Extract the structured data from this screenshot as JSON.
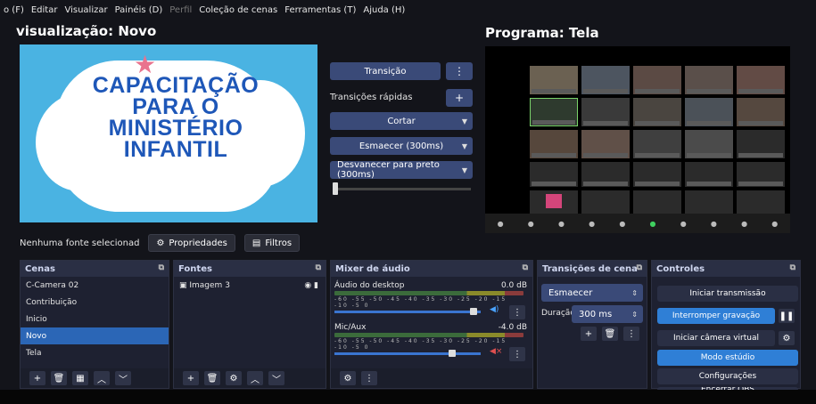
{
  "menu": [
    "o (F)",
    "Editar",
    "Visualizar",
    "Painéis (D)",
    "Perfil",
    "Coleção de cenas",
    "Ferramentas (T)",
    "Ajuda (H)"
  ],
  "preview": {
    "title": "visualização: Novo",
    "lines": [
      "CAPACITAÇÃO",
      "PARA O",
      "MINISTÉRIO",
      "INFANTIL"
    ]
  },
  "program": {
    "title": "Programa: Tela"
  },
  "transitions_panel": {
    "transition_label": "Transição",
    "quick_label": "Transições rápidas",
    "add_symbol": "+",
    "options": [
      "Cortar",
      "Esmaecer (300ms)",
      "Desvanecer para preto (300ms)"
    ],
    "dots": "⋮"
  },
  "source_bar": {
    "none_selected": "Nenhuma fonte selecionad",
    "properties": "Propriedades",
    "filters": "Filtros"
  },
  "scenes": {
    "header": "Cenas",
    "items": [
      "C-Camera 02",
      "Contribuição",
      "Inicio",
      "Novo",
      "Tela"
    ],
    "selected_index": 3
  },
  "sources": {
    "header": "Fontes",
    "items": [
      "Imagem 3"
    ]
  },
  "mixer": {
    "header": "Mixer de áudio",
    "channels": [
      {
        "name": "Áudio do desktop",
        "level": "0.0 dB",
        "volume_fraction": 0.95
      },
      {
        "name": "Mic/Aux",
        "level": "-4.0 dB",
        "volume_fraction": 0.8
      }
    ],
    "scale": "-60 -55 -50 -45 -40 -35 -30 -25 -20 -15 -10 -5 0"
  },
  "scene_transitions": {
    "header": "Transições de cena",
    "selected": "Esmaecer",
    "duration_label": "Duração",
    "duration_value": "300 ms"
  },
  "controls": {
    "header": "Controles",
    "buttons": [
      "Iniciar transmissão",
      "Interromper gravação",
      "Iniciar câmera virtual",
      "Modo estúdio",
      "Configurações",
      "Encerrar OBS"
    ]
  },
  "colors": {
    "accent": "#2f7fd6",
    "panel": "#1e2131",
    "button": "#3a4a78"
  }
}
